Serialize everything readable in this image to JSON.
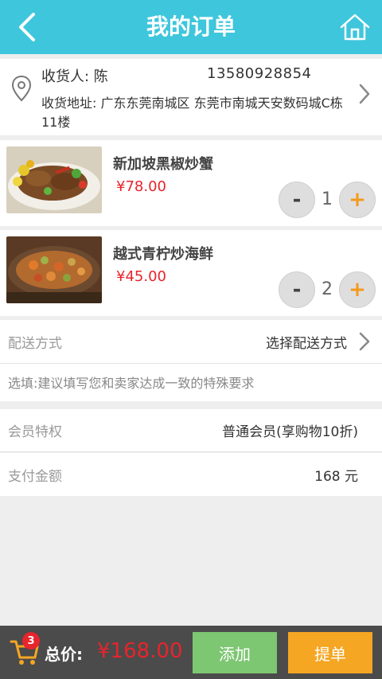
{
  "header": {
    "title": "我的订单",
    "back_icon": "back-chevron-icon",
    "home_icon": "home-icon"
  },
  "address": {
    "receiver": "收货人: 陈",
    "phone": "13580928854",
    "address": "收货地址: 广东东莞南城区 东莞市南城天安数码城C栋11楼"
  },
  "items": [
    {
      "name": "新加坡黑椒炒蟹",
      "price": "¥78.00",
      "quantity": "1",
      "minus": "-",
      "plus": "+"
    },
    {
      "name": "越式青柠炒海鲜",
      "price": "¥45.00",
      "quantity": "2",
      "minus": "-",
      "plus": "+"
    }
  ],
  "delivery": {
    "label": "配送方式",
    "value": "选择配送方式"
  },
  "note": {
    "placeholder": "选填:建议填写您和卖家达成一致的特殊要求"
  },
  "membership": {
    "label": "会员特权",
    "value": "普通会员(享购物10折)"
  },
  "payment": {
    "label": "支付金额",
    "value": "168 元"
  },
  "footer": {
    "cart_count": "3",
    "total_label": "总价:",
    "total_value": "¥168.00",
    "add_button": "添加",
    "submit_button": "提单"
  },
  "colors": {
    "header": "#3ec6dc",
    "price": "#e8242c",
    "add_button": "#7dc672",
    "submit_button": "#f5a623",
    "footer": "#4b4b4b"
  }
}
